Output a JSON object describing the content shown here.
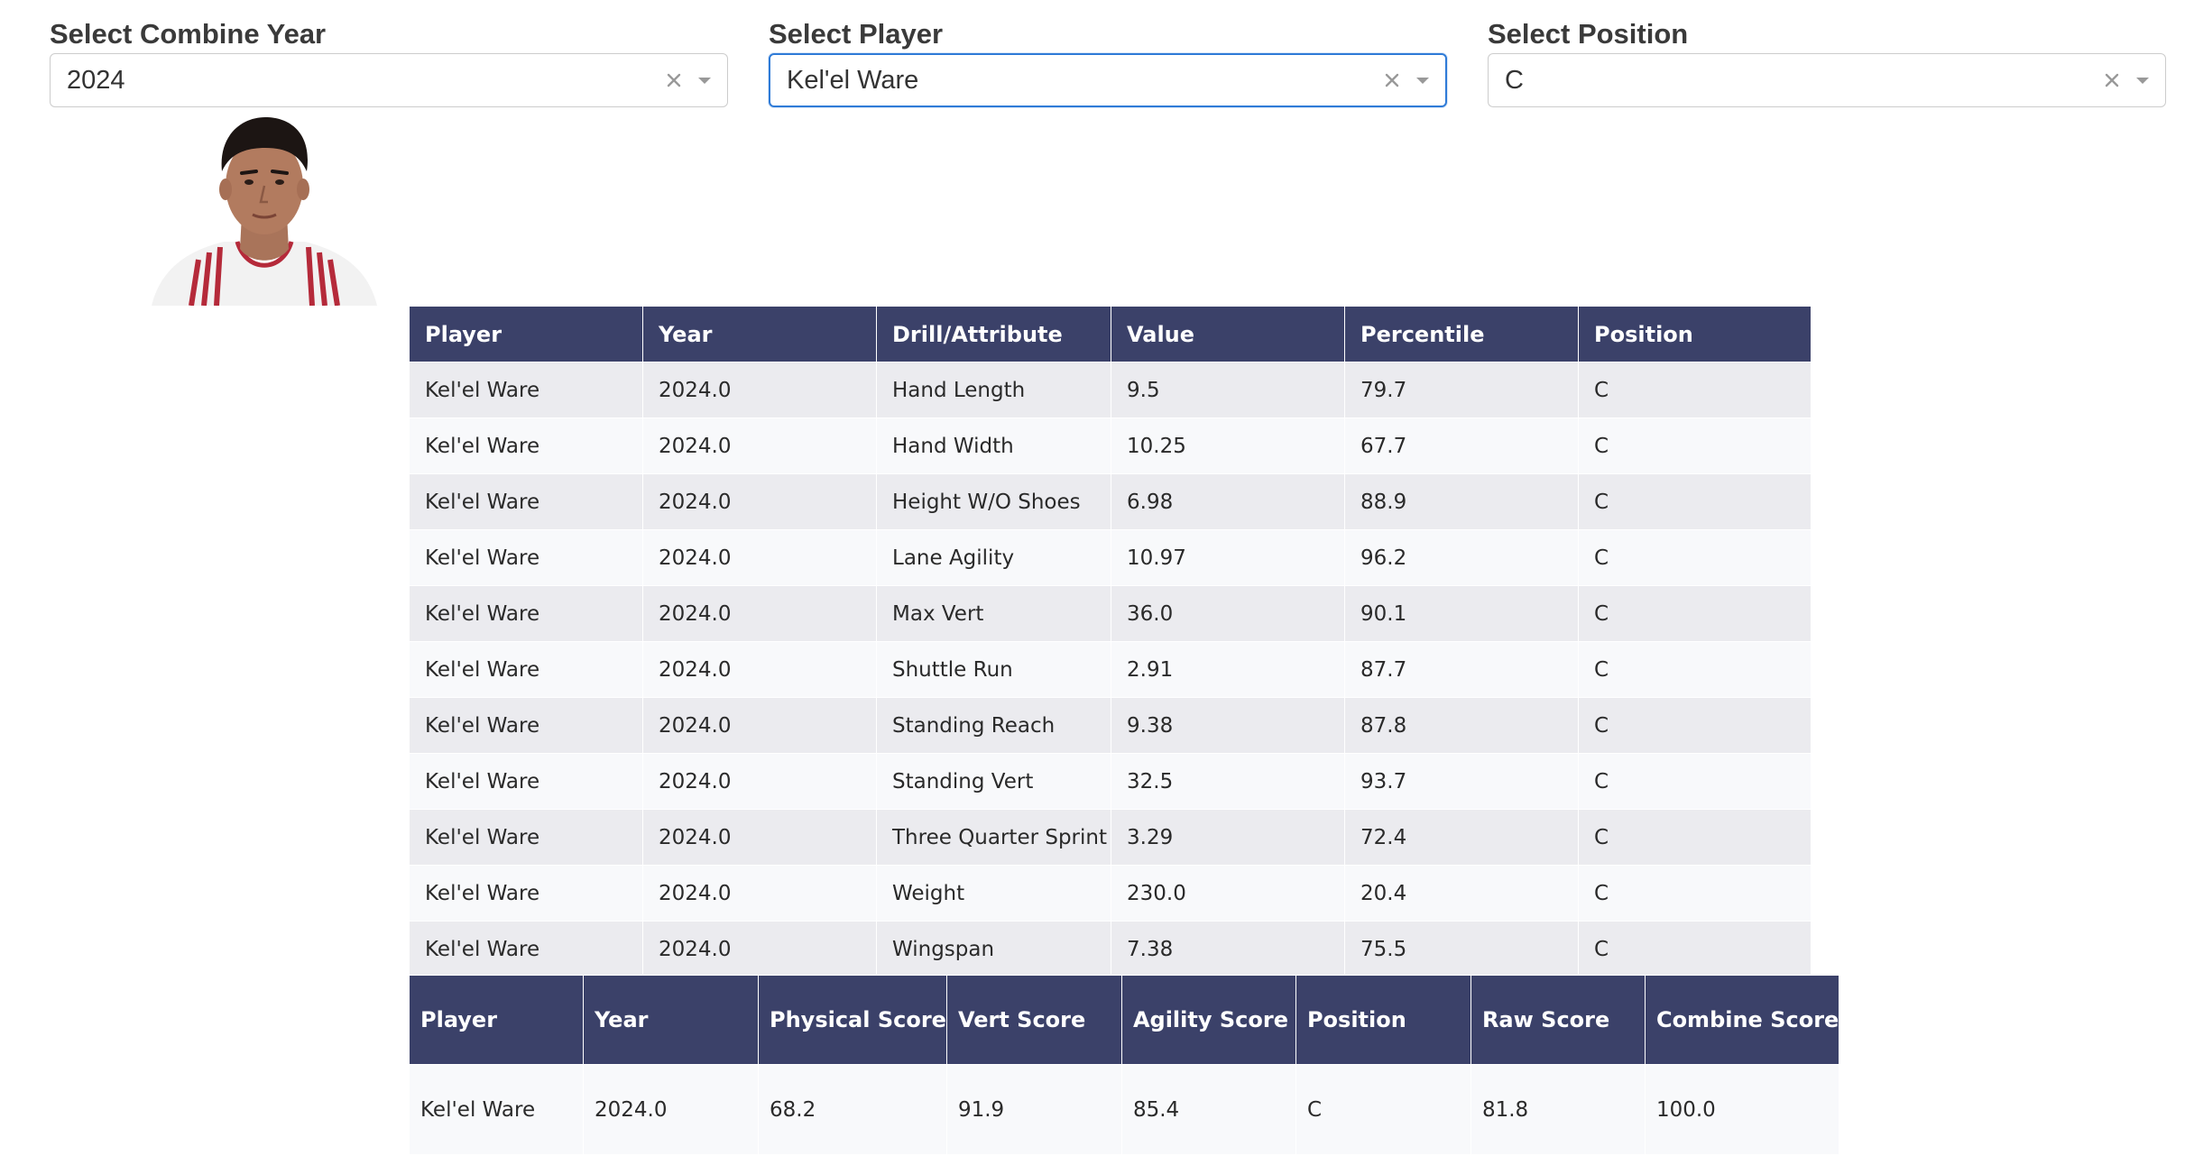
{
  "filters": {
    "year": {
      "label": "Select Combine Year",
      "value": "2024"
    },
    "player": {
      "label": "Select Player",
      "value": "Kel'el Ware"
    },
    "position": {
      "label": "Select Position",
      "value": "C"
    }
  },
  "icons": {
    "clear": "close-icon",
    "dropdown": "chevron-down-icon"
  },
  "colors": {
    "header_bg": "#3b4169",
    "row_odd": "#ebebef",
    "row_even": "#f8f9fb",
    "focus_border": "#2f7bd7"
  },
  "attributes_table": {
    "headers": [
      "Player",
      "Year",
      "Drill/Attribute",
      "Value",
      "Percentile",
      "Position"
    ],
    "rows": [
      [
        "Kel'el Ware",
        "2024.0",
        "Hand Length",
        "9.5",
        "79.7",
        "C"
      ],
      [
        "Kel'el Ware",
        "2024.0",
        "Hand Width",
        "10.25",
        "67.7",
        "C"
      ],
      [
        "Kel'el Ware",
        "2024.0",
        "Height W/O Shoes",
        "6.98",
        "88.9",
        "C"
      ],
      [
        "Kel'el Ware",
        "2024.0",
        "Lane Agility",
        "10.97",
        "96.2",
        "C"
      ],
      [
        "Kel'el Ware",
        "2024.0",
        "Max Vert",
        "36.0",
        "90.1",
        "C"
      ],
      [
        "Kel'el Ware",
        "2024.0",
        "Shuttle Run",
        "2.91",
        "87.7",
        "C"
      ],
      [
        "Kel'el Ware",
        "2024.0",
        "Standing Reach",
        "9.38",
        "87.8",
        "C"
      ],
      [
        "Kel'el Ware",
        "2024.0",
        "Standing Vert",
        "32.5",
        "93.7",
        "C"
      ],
      [
        "Kel'el Ware",
        "2024.0",
        "Three Quarter Sprint",
        "3.29",
        "72.4",
        "C"
      ],
      [
        "Kel'el Ware",
        "2024.0",
        "Weight",
        "230.0",
        "20.4",
        "C"
      ],
      [
        "Kel'el Ware",
        "2024.0",
        "Wingspan",
        "7.38",
        "75.5",
        "C"
      ]
    ]
  },
  "scores_table": {
    "headers": [
      "Player",
      "Year",
      "Physical Score",
      "Vert Score",
      "Agility Score",
      "Position",
      "Raw Score",
      "Combine Score"
    ],
    "rows": [
      [
        "Kel'el Ware",
        "2024.0",
        "68.2",
        "91.9",
        "85.4",
        "C",
        "81.8",
        "100.0"
      ]
    ]
  }
}
